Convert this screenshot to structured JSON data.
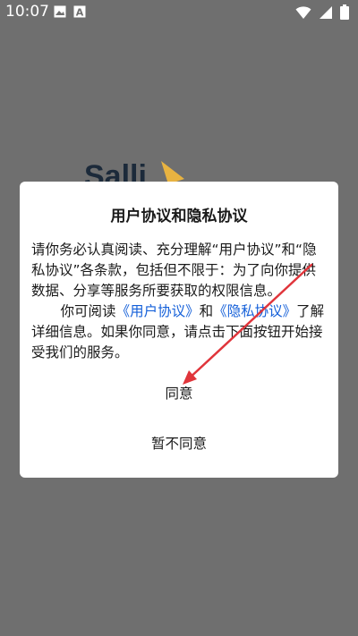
{
  "status_bar": {
    "time": "10:07",
    "left_icons": [
      "image-icon",
      "text-icon"
    ],
    "right_icons": [
      "wifi-icon",
      "signal-icon",
      "battery-icon"
    ]
  },
  "background": {
    "logo_text": "Salli",
    "logo_mark_color": "#e8b341"
  },
  "dialog": {
    "title": "用户协议和隐私协议",
    "body_para1": "请你务必认真阅读、充分理解“用户协议”和“隐私协议”各条款，包括但不限于：为了向你提供数据、分享等服务所要获取的权限信息。",
    "body_para2_prefix": "你可阅读",
    "user_agreement_link": "《用户协议》",
    "and_text": "和",
    "privacy_link": "《隐私协议》",
    "body_para2_suffix": "了解详细信息。如果你同意，请点击下面按钮开始接受我们的服务。",
    "agree_label": "同意",
    "disagree_label": "暂不同意",
    "link_color": "#1560d9"
  },
  "annotation": {
    "arrow_color": "#e0353b"
  }
}
